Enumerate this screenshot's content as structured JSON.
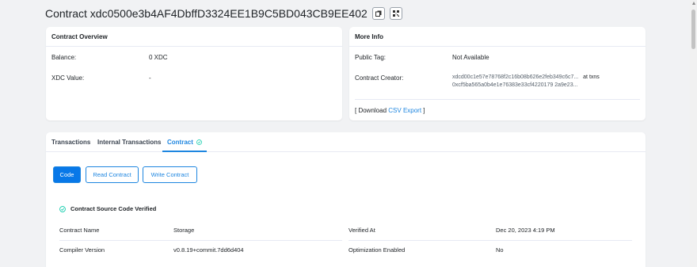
{
  "header": {
    "title": "Contract xdc0500e3b4AF4DbffD3324EE1B9C5BD043CB9EE402",
    "copy_icon": "copy-icon",
    "qr_icon": "qr-code-icon"
  },
  "overview": {
    "title": "Contract Overview",
    "balance_label": "Balance:",
    "balance_value": "0 XDC",
    "xdc_value_label": "XDC Value:",
    "xdc_value": "-"
  },
  "more_info": {
    "title": "More Info",
    "public_tag_label": "Public Tag:",
    "public_tag_value": "Not Available",
    "creator_label": "Contract Creator:",
    "creator_address": "xdcd00c1e57e78768f2c16b08b626e2feb349c6c7...",
    "creator_at": "at txns",
    "creator_txn": "0xcf5ba565a0b4e1e76383e33cf4220179 2a9e23...",
    "download_prefix": "[ Download",
    "download_link": "CSV Export",
    "download_suffix": "]"
  },
  "tabs": [
    {
      "label": "Transactions"
    },
    {
      "label": "Internal Transactions"
    },
    {
      "label": "Contract"
    }
  ],
  "code_buttons": {
    "code": "Code",
    "read": "Read Contract",
    "write": "Write Contract"
  },
  "verified": {
    "label": "Contract Source Code Verified"
  },
  "contract_info": {
    "name_label": "Contract Name",
    "name_value": "Storage",
    "verified_at_label": "Verified At",
    "verified_at_value": "Dec 20, 2023 4:19 PM",
    "compiler_label": "Compiler Version",
    "compiler_value": "v0.8.19+commit.7dd6d404",
    "optimization_label": "Optimization Enabled",
    "optimization_value": "No"
  },
  "colors": {
    "accent": "#1e86e0",
    "success": "#00c9a7",
    "background": "#f1f2f4"
  }
}
